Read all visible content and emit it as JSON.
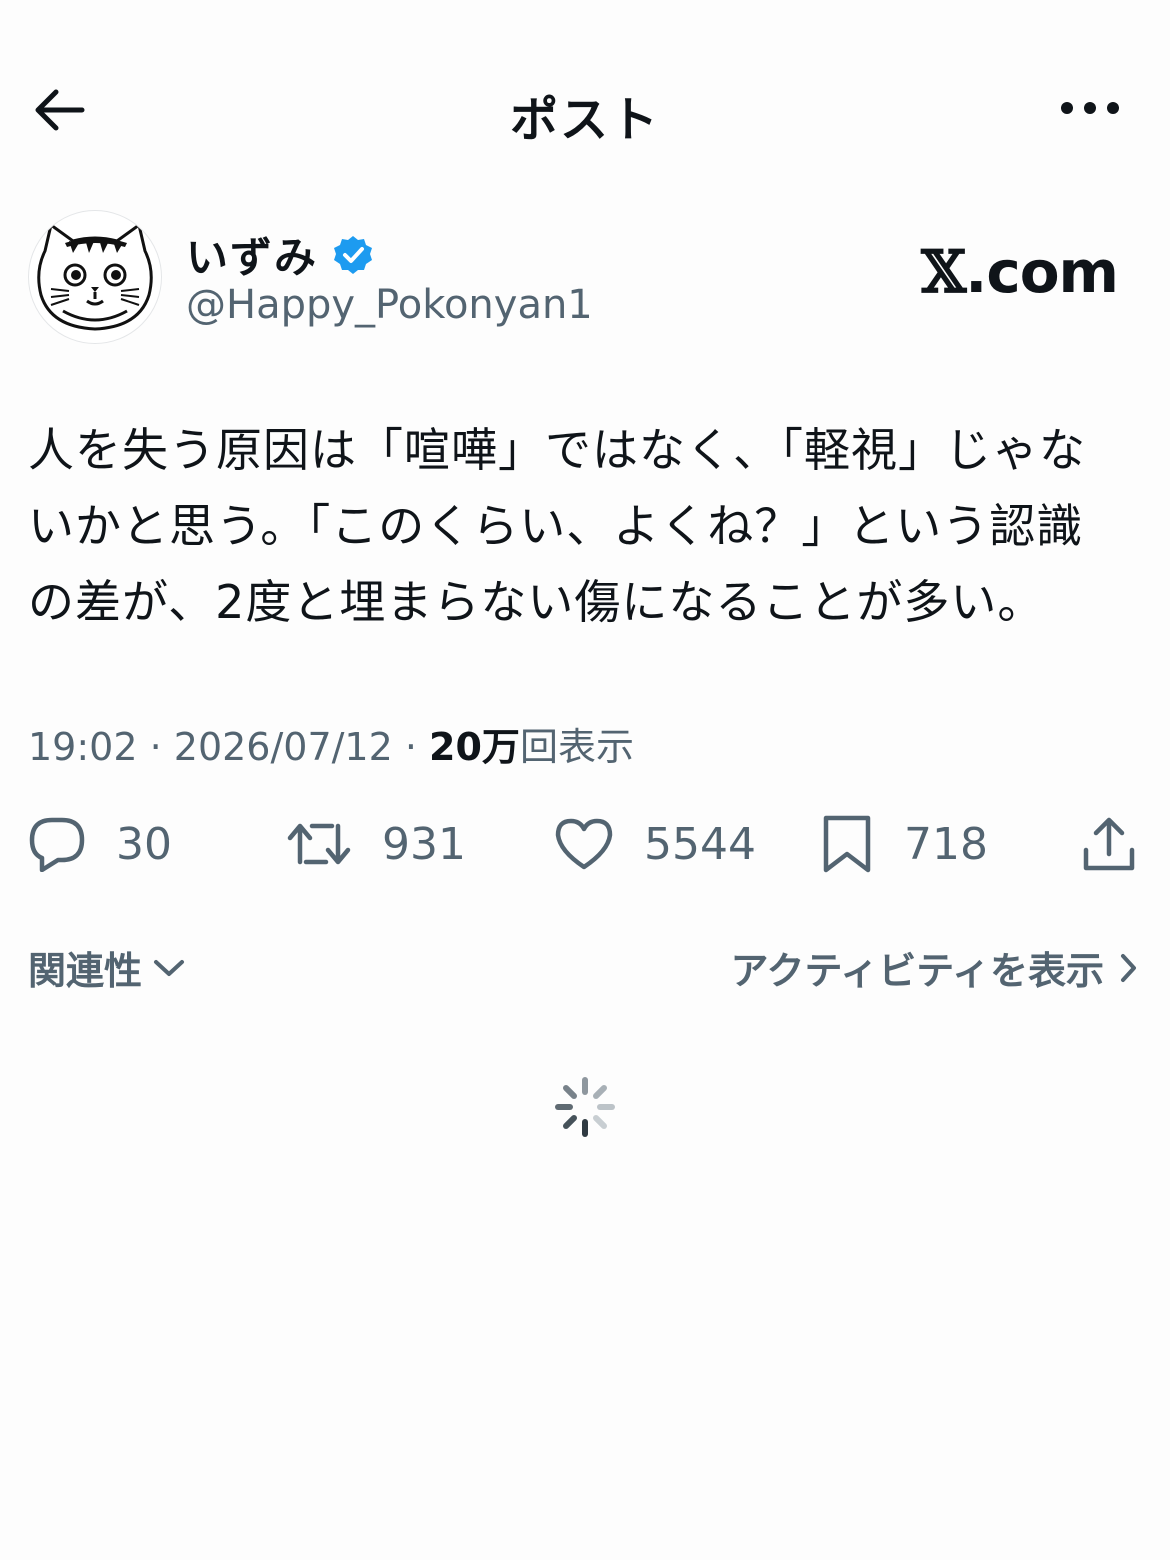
{
  "header": {
    "title": "ポスト"
  },
  "author": {
    "display_name": "いずみ",
    "handle": "@Happy_Pokonyan1",
    "verified": true,
    "watermark_x": "𝕏",
    "watermark_suffix": ".com"
  },
  "tweet": {
    "text_lines": [
      "人を失う原因は「喧嘩」ではなく、「軽視」じゃな",
      "いかと思う。「このくらい、よくね？」という認識",
      "の差が、2度と埋まらない傷になることが多い。"
    ],
    "time": "19:02",
    "date": "2026/07/12",
    "views_count": "20万",
    "views_label": "回表示",
    "separator": " · "
  },
  "actions": {
    "reply_count": "30",
    "repost_count": "931",
    "like_count": "5544",
    "bookmark_count": "718"
  },
  "sort": {
    "relevance_label": "関連性",
    "activity_label": "アクティビティを表示"
  },
  "colors": {
    "text_primary": "#0f1419",
    "text_secondary": "#536471",
    "verified_blue": "#1d9bf0",
    "background": "#fdfdfd"
  }
}
